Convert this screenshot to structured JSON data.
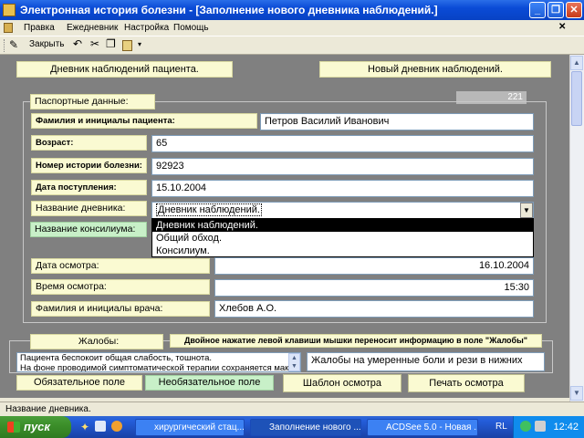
{
  "window": {
    "title": "Электронная история болезни - [Заполнение нового дневника наблюдений.]",
    "minimize": "_",
    "restore": "❐",
    "close": "✕"
  },
  "menu": [
    "Правка",
    "Ежедневник",
    "Настройка",
    "Помощь"
  ],
  "toolbar": {
    "close_label": "Закрыть"
  },
  "header": {
    "diary_title": "Дневник наблюдений пациента.",
    "new_diary": "Новый дневник наблюдений.",
    "record_number": "221"
  },
  "passport": {
    "group_title": "Паспортные данные:",
    "patient_name_label": "Фамилия и инициалы пациента:",
    "patient_name": "Петров Василий Иванович",
    "age_label": "Возраст:",
    "age": "65",
    "history_label": "Номер истории болезни:",
    "history_number": "92923",
    "admission_label": "Дата поступления:",
    "admission_date": "15.10.2004",
    "diary_name_label": "Название дневника:",
    "diary_name_value": "Дневник наблюдений.",
    "diary_options": [
      "Дневник наблюдений.",
      "Общий обход.",
      "Консилиум."
    ],
    "council_label": "Название консилиума:",
    "exam_date_label": "Дата осмотра:",
    "exam_date": "16.10.2004",
    "exam_time_label": "Время осмотра:",
    "exam_time": "15:30",
    "doctor_label": "Фамилия и инициалы врача:",
    "doctor_name": "Хлебов А.О."
  },
  "complaints": {
    "group_title": "Жалобы:",
    "hint": "Двойное нажатие левой клавиши мышки переносит информацию в поле \"Жалобы\"",
    "list_line1": "Пациента беспокоит общая слабость, тошнота.",
    "list_line2": "На фоне проводимой симптоматической терапии сохраняется макрогем",
    "text": "Жалобы на умеренные боли и рези в нижних"
  },
  "legend": {
    "required": "Обязательное поле",
    "optional": "Необязательное поле"
  },
  "buttons": {
    "template": "Шаблон осмотра",
    "print": "Печать осмотра"
  },
  "status": "Название дневника.",
  "taskbar": {
    "start": "пуск",
    "items": [
      "хирургический стац...",
      "Заполнение нового ...",
      "ACDSee 5.0 - Новая ..."
    ],
    "lang": "RL",
    "time": "12:42"
  }
}
